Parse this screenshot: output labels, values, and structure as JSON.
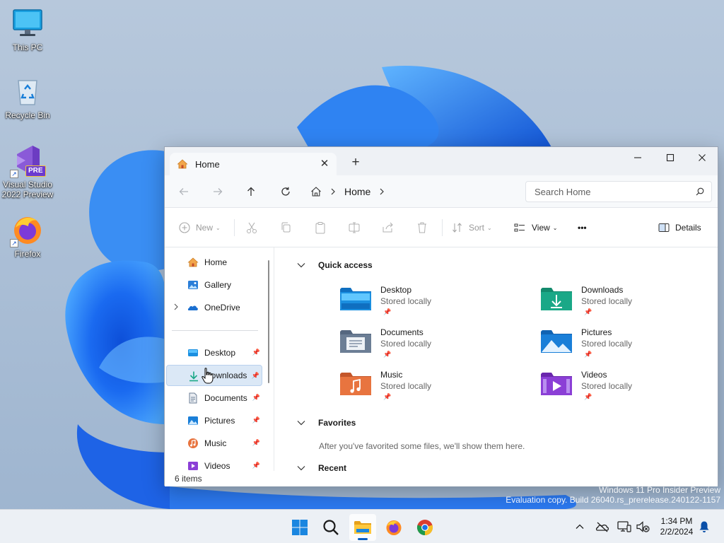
{
  "desktop": {
    "icons": [
      {
        "label": "This PC",
        "icon": "monitor-icon"
      },
      {
        "label": "Recycle Bin",
        "icon": "recycle-bin-icon"
      },
      {
        "label": "Visual Studio 2022 Preview",
        "line1": "Visual Studio",
        "line2": "2022 Preview",
        "badge": "PRE",
        "icon": "visual-studio-icon"
      },
      {
        "label": "Firefox",
        "icon": "firefox-icon"
      }
    ]
  },
  "window": {
    "tab_title": "Home",
    "tab_close": "✕",
    "new_tab": "+",
    "controls": {
      "minimize": "minimize",
      "maximize": "maximize",
      "close": "close"
    }
  },
  "navbar": {
    "breadcrumb": "Home",
    "search_placeholder": "Search Home"
  },
  "commandbar": {
    "new_label": "New",
    "sort_label": "Sort",
    "view_label": "View",
    "more_label": "•••",
    "details_label": "Details"
  },
  "sidebar": {
    "items": [
      {
        "label": "Home",
        "icon": "home-icon"
      },
      {
        "label": "Gallery",
        "icon": "gallery-icon"
      },
      {
        "label": "OneDrive",
        "icon": "onedrive-icon",
        "expandable": true
      },
      {
        "label": "Desktop",
        "icon": "desktop-folder-icon",
        "pinned": true
      },
      {
        "label": "Downloads",
        "icon": "download-icon",
        "pinned": true,
        "selected": true
      },
      {
        "label": "Documents",
        "icon": "documents-icon",
        "pinned": true
      },
      {
        "label": "Pictures",
        "icon": "pictures-icon",
        "pinned": true
      },
      {
        "label": "Music",
        "icon": "music-icon",
        "pinned": true
      },
      {
        "label": "Videos",
        "icon": "videos-icon",
        "pinned": true
      }
    ]
  },
  "main": {
    "quick_access": {
      "title": "Quick access",
      "items": [
        {
          "name": "Desktop",
          "sub": "Stored locally",
          "icon": "desktop-folder-icon",
          "color": "#1b8fe0"
        },
        {
          "name": "Downloads",
          "sub": "Stored locally",
          "icon": "downloads-folder-icon",
          "color": "#1aa887"
        },
        {
          "name": "Documents",
          "sub": "Stored locally",
          "icon": "documents-folder-icon",
          "color": "#6c7e95"
        },
        {
          "name": "Pictures",
          "sub": "Stored locally",
          "icon": "pictures-folder-icon",
          "color": "#1a7fd8"
        },
        {
          "name": "Music",
          "sub": "Stored locally",
          "icon": "music-folder-icon",
          "color": "#e8743f"
        },
        {
          "name": "Videos",
          "sub": "Stored locally",
          "icon": "videos-folder-icon",
          "color": "#8b3fd6"
        }
      ]
    },
    "favorites": {
      "title": "Favorites",
      "hint": "After you've favorited some files, we'll show them here."
    },
    "recent": {
      "title": "Recent"
    }
  },
  "statusbar": {
    "items_count": "6 items"
  },
  "watermark": {
    "line1": "Windows 11 Pro Insider Preview",
    "line2": "Evaluation copy. Build 26040.rs_prerelease.240122-1157"
  },
  "taskbar": {
    "apps": [
      "start-icon",
      "search-icon",
      "file-explorer-icon",
      "firefox-icon",
      "chrome-icon"
    ],
    "clock": {
      "time": "1:34 PM",
      "date": "2/2/2024"
    }
  },
  "colors": {
    "accent": "#0a5fc0",
    "selected_bg": "#dbe8f6",
    "taskbar_bg": "#ecf0f5"
  }
}
